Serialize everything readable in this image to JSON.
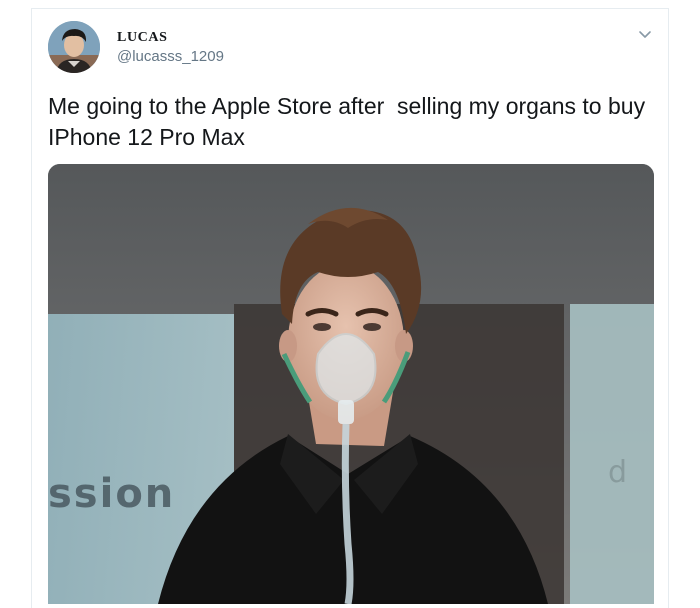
{
  "tweet": {
    "display_name": "LUCAS",
    "handle": "@lucasss_1209",
    "text": "Me going to the Apple Store after  selling my organs to buy IPhone 12 Pro Max",
    "media": {
      "background_sign_text": "ssion"
    }
  },
  "icons": {
    "menu": "chevron-down-icon"
  },
  "colors": {
    "text": "#14171a",
    "handle": "#657786",
    "border": "#e6ecf0"
  }
}
